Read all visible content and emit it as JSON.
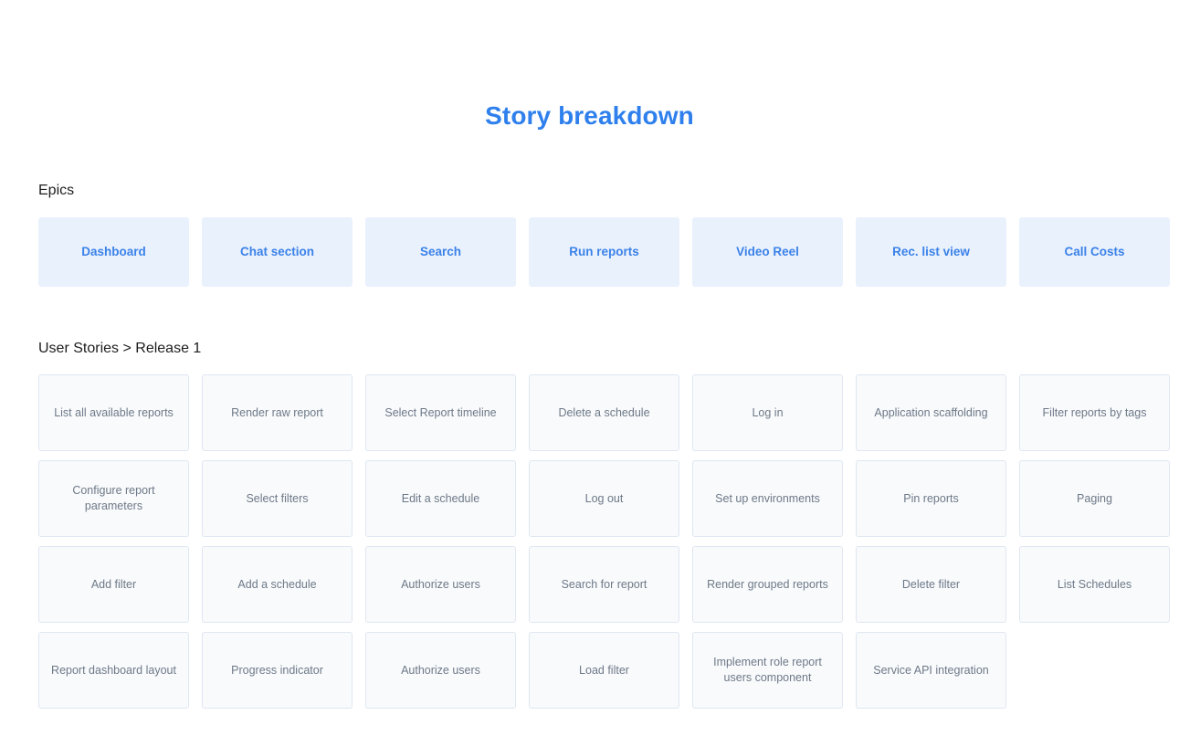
{
  "page": {
    "title": "Story breakdown",
    "title_color": "#2f80ed",
    "background_color": "#ffffff"
  },
  "epics_section": {
    "label": "Epics",
    "card_background": "#e9f1fd",
    "card_text_color": "#3b82e8",
    "items": [
      {
        "label": "Dashboard"
      },
      {
        "label": "Chat section"
      },
      {
        "label": "Search"
      },
      {
        "label": "Run reports"
      },
      {
        "label": "Video Reel"
      },
      {
        "label": "Rec. list view"
      },
      {
        "label": "Call Costs"
      }
    ]
  },
  "stories_section": {
    "label": "User Stories > Release 1",
    "card_background": "#f8fafc",
    "card_border_color": "#dfe7f1",
    "card_text_color": "#6e7987",
    "rows": [
      {
        "items": [
          {
            "label": "List all available reports"
          },
          {
            "label": "Render raw report"
          },
          {
            "label": "Select Report timeline"
          },
          {
            "label": "Delete a schedule"
          },
          {
            "label": "Log in"
          },
          {
            "label": "Application scaffolding"
          },
          {
            "label": "Filter reports by tags"
          }
        ]
      },
      {
        "items": [
          {
            "label": "Configure report parameters"
          },
          {
            "label": "Select filters"
          },
          {
            "label": "Edit a schedule"
          },
          {
            "label": "Log out"
          },
          {
            "label": "Set up environments"
          },
          {
            "label": "Pin reports"
          },
          {
            "label": "Paging"
          }
        ]
      },
      {
        "items": [
          {
            "label": "Add filter"
          },
          {
            "label": "Add a schedule"
          },
          {
            "label": "Authorize users"
          },
          {
            "label": "Search for report"
          },
          {
            "label": "Render grouped reports"
          },
          {
            "label": "Delete filter"
          },
          {
            "label": "List Schedules"
          }
        ]
      },
      {
        "items": [
          {
            "label": "Report dashboard layout"
          },
          {
            "label": "Progress indicator"
          },
          {
            "label": "Authorize users"
          },
          {
            "label": "Load filter"
          },
          {
            "label": "Implement role report users component"
          },
          {
            "label": "Service API integration"
          }
        ]
      }
    ]
  }
}
